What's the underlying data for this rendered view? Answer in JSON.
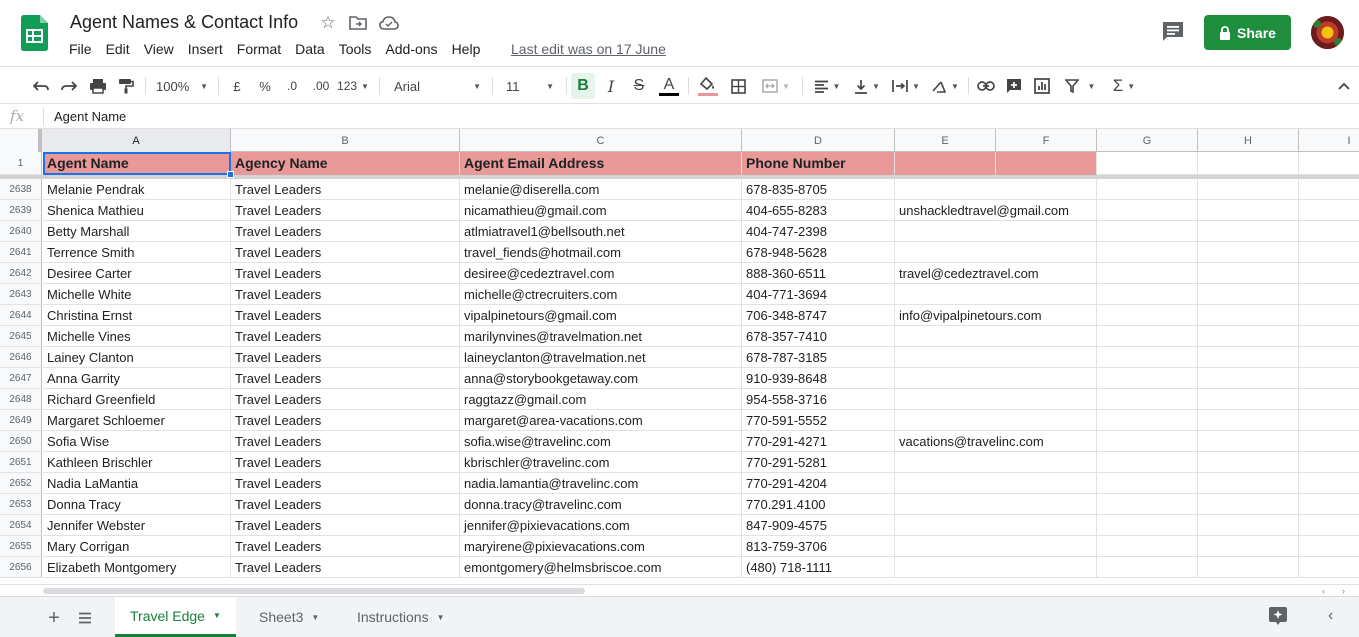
{
  "app": {
    "document_title": "Agent Names & Contact Info",
    "last_edit": "Last edit was on 17 June",
    "share_label": "Share"
  },
  "menu": [
    "File",
    "Edit",
    "View",
    "Insert",
    "Format",
    "Data",
    "Tools",
    "Add-ons",
    "Help"
  ],
  "toolbar": {
    "zoom": "100%",
    "currency": "£",
    "percent": "%",
    "decrease_decimal": ".0",
    "increase_decimal": ".00",
    "number_format": "123",
    "font_family": "Arial",
    "font_size": "11",
    "bold": "B",
    "italic": "I",
    "strikethrough": "S",
    "text_color": "A",
    "text_color_hex": "#000000",
    "fill_color_hex": "#ea9999"
  },
  "formula_bar": {
    "fx": "fx",
    "content": "Agent Name"
  },
  "columns": [
    "A",
    "B",
    "C",
    "D",
    "E",
    "F",
    "G",
    "H",
    "I"
  ],
  "header_row": {
    "number": "1",
    "cells": [
      "Agent Name",
      "Agency Name",
      "Agent Email Address",
      "Phone Number",
      "",
      ""
    ]
  },
  "rows": [
    {
      "num": "2638",
      "cells": [
        "Melanie Pendrak",
        "Travel Leaders",
        "melanie@diserella.com",
        "678-835-8705",
        ""
      ]
    },
    {
      "num": "2639",
      "cells": [
        "Shenica Mathieu",
        "Travel Leaders",
        "nicamathieu@gmail.com",
        "404-655-8283",
        "unshackledtravel@gmail.com"
      ]
    },
    {
      "num": "2640",
      "cells": [
        "Betty Marshall",
        "Travel Leaders",
        "atlmiatravel1@bellsouth.net",
        "404-747-2398",
        ""
      ]
    },
    {
      "num": "2641",
      "cells": [
        "Terrence Smith",
        "Travel Leaders",
        "travel_fiends@hotmail.com",
        "678-948-5628",
        ""
      ]
    },
    {
      "num": "2642",
      "cells": [
        "Desiree Carter",
        "Travel Leaders",
        "desiree@cedeztravel.com",
        "888-360-6511",
        "travel@cedeztravel.com"
      ]
    },
    {
      "num": "2643",
      "cells": [
        "Michelle White",
        "Travel Leaders",
        "michelle@ctrecruiters.com",
        "404-771-3694",
        ""
      ]
    },
    {
      "num": "2644",
      "cells": [
        "Christina Ernst",
        "Travel Leaders",
        "vipalpinetours@gmail.com",
        "706-348-8747",
        "info@vipalpinetours.com"
      ]
    },
    {
      "num": "2645",
      "cells": [
        "Michelle Vines",
        "Travel Leaders",
        "marilynvines@travelmation.net",
        "678-357-7410",
        ""
      ]
    },
    {
      "num": "2646",
      "cells": [
        "Lainey Clanton",
        "Travel Leaders",
        "laineyclanton@travelmation.net",
        "678-787-3185",
        ""
      ]
    },
    {
      "num": "2647",
      "cells": [
        "Anna Garrity",
        "Travel Leaders",
        "anna@storybookgetaway.com",
        "910-939-8648",
        ""
      ]
    },
    {
      "num": "2648",
      "cells": [
        "Richard Greenfield",
        "Travel Leaders",
        "raggtazz@gmail.com",
        "954-558-3716",
        ""
      ]
    },
    {
      "num": "2649",
      "cells": [
        "Margaret Schloemer",
        "Travel Leaders",
        "margaret@area-vacations.com",
        "770-591-5552",
        ""
      ]
    },
    {
      "num": "2650",
      "cells": [
        "Sofia Wise",
        "Travel Leaders",
        "sofia.wise@travelinc.com",
        "770-291-4271",
        "vacations@travelinc.com"
      ]
    },
    {
      "num": "2651",
      "cells": [
        "Kathleen Brischler",
        "Travel Leaders",
        "kbrischler@travelinc.com",
        "770-291-5281",
        ""
      ]
    },
    {
      "num": "2652",
      "cells": [
        "Nadia LaMantia",
        "Travel Leaders",
        "nadia.lamantia@travelinc.com",
        "770-291-4204",
        ""
      ]
    },
    {
      "num": "2653",
      "cells": [
        "Donna Tracy",
        "Travel Leaders",
        "donna.tracy@travelinc.com",
        "770.291.4100",
        ""
      ]
    },
    {
      "num": "2654",
      "cells": [
        "Jennifer Webster",
        "Travel Leaders",
        "jennifer@pixievacations.com",
        "847-909-4575",
        ""
      ]
    },
    {
      "num": "2655",
      "cells": [
        "Mary Corrigan",
        "Travel Leaders",
        "maryirene@pixievacations.com",
        "813-759-3706",
        ""
      ]
    },
    {
      "num": "2656",
      "cells": [
        "Elizabeth Montgomery",
        "Travel Leaders",
        "emontgomery@helmsbriscoe.com",
        "(480) 718-1111",
        ""
      ]
    }
  ],
  "sheet_tabs": [
    {
      "label": "Travel Edge",
      "active": true
    },
    {
      "label": "Sheet3",
      "active": false
    },
    {
      "label": "Instructions",
      "active": false
    }
  ],
  "colors": {
    "header_fill": "#ea9999",
    "share_green": "#1e8e3e",
    "active_tab_green": "#188038",
    "selection_blue": "#1a73e8"
  }
}
